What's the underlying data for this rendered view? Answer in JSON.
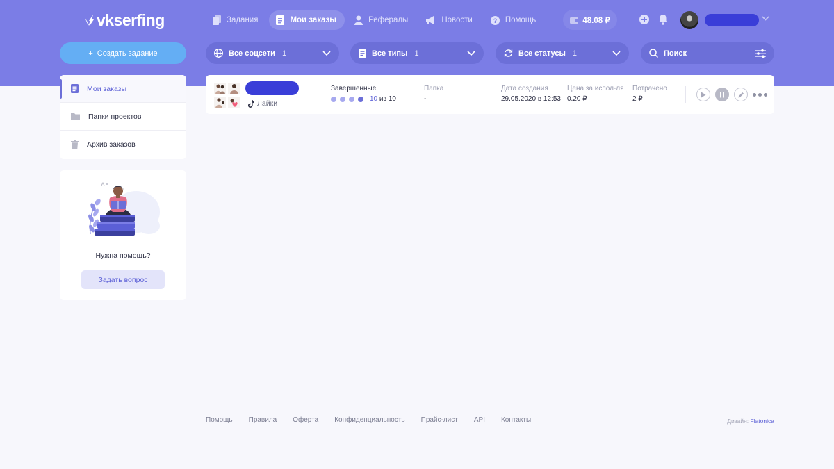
{
  "header": {
    "logo_text": "vkserfing",
    "nav": [
      {
        "label": "Задания",
        "icon": "copy-icon",
        "active": false
      },
      {
        "label": "Мои заказы",
        "icon": "document-icon",
        "active": true
      },
      {
        "label": "Рефералы",
        "icon": "user-icon",
        "active": false
      },
      {
        "label": "Новости",
        "icon": "megaphone-icon",
        "active": false
      },
      {
        "label": "Помощь",
        "icon": "question-icon",
        "active": false
      }
    ],
    "balance": "48.08 ₽"
  },
  "toolbar": {
    "create_label": "Создать задание",
    "filters": [
      {
        "label": "Все соцсети",
        "count": "1",
        "icon": "globe-icon"
      },
      {
        "label": "Все типы",
        "count": "1",
        "icon": "list-icon"
      },
      {
        "label": "Все статусы",
        "count": "1",
        "icon": "refresh-icon"
      }
    ],
    "search_placeholder": "Поиск"
  },
  "sidebar": {
    "items": [
      {
        "label": "Мои заказы",
        "icon": "document-icon",
        "active": true
      },
      {
        "label": "Папки проектов",
        "icon": "folder-icon",
        "active": false
      },
      {
        "label": "Архив заказов",
        "icon": "trash-icon",
        "active": false
      }
    ],
    "help": {
      "text": "Нужна помощь?",
      "button": "Задать вопрос"
    }
  },
  "order": {
    "type": "Лайки",
    "platform_icon": "tiktok-icon",
    "status": "Завершенные",
    "progress_done": "10",
    "progress_rest": "из 10",
    "folder_header": "Папка",
    "folder_value": "-",
    "created_header": "Дата создания",
    "created_value": "29.05.2020 в 12:53",
    "price_header": "Цена за испол-ля",
    "price_value": "0.20 ₽",
    "spent_header": "Потрачено",
    "spent_value": "2 ₽"
  },
  "footer": {
    "links": [
      "Помощь",
      "Правила",
      "Оферта",
      "Конфиденциальность",
      "Прайс-лист",
      "API",
      "Контакты"
    ],
    "design_label": "Дизайн:",
    "design_link": "Flatonica"
  },
  "colors": {
    "header": "#7b7de6",
    "accent": "#5b5fd6",
    "create_button": "#64aef4",
    "spent": "#f25c5c"
  }
}
